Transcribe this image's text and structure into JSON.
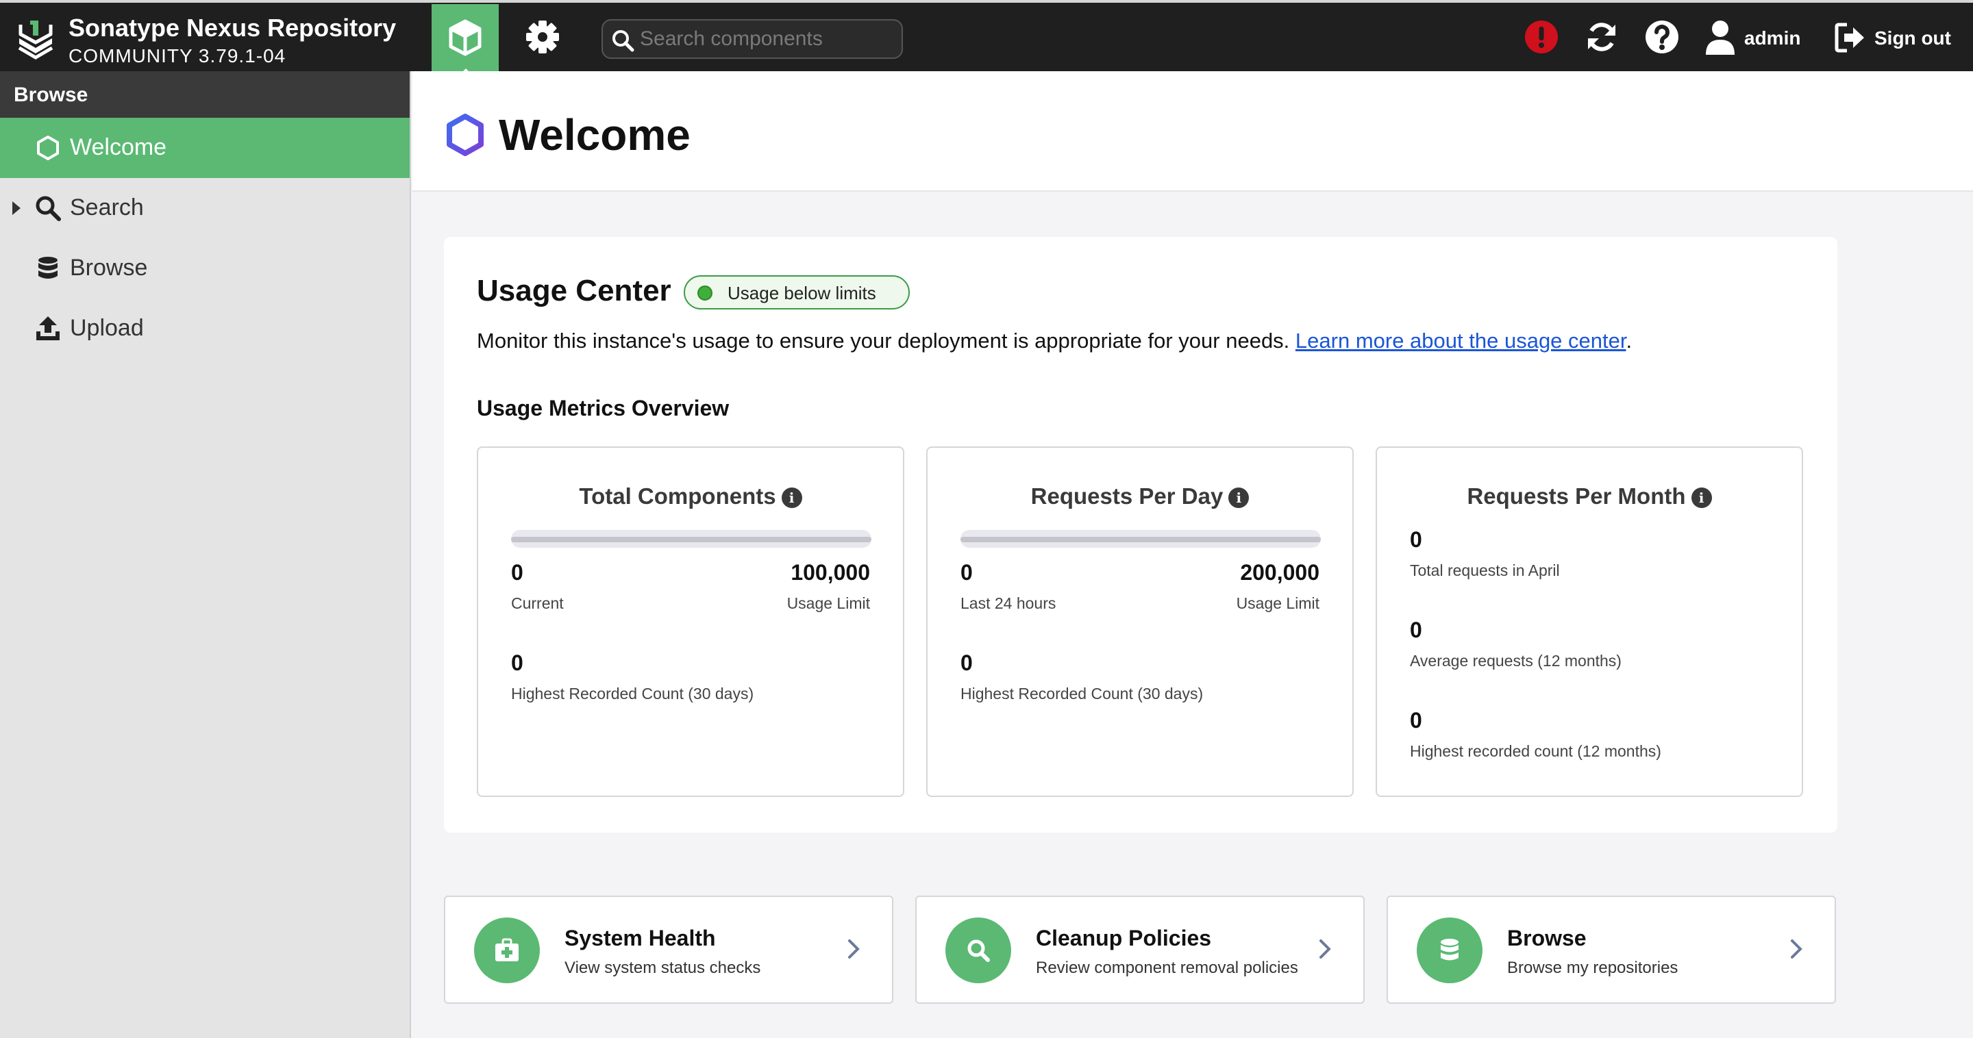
{
  "app": {
    "name": "Sonatype Nexus Repository",
    "version": "COMMUNITY 3.79.1-04"
  },
  "topbar": {
    "search_placeholder": "Search components",
    "user_label": "admin",
    "signout_label": "Sign out",
    "accent_color": "#5bb974",
    "alert_color": "#d0101c"
  },
  "sidebar": {
    "header": "Browse",
    "items": [
      {
        "label": "Welcome",
        "icon": "hexagon-icon",
        "active": true
      },
      {
        "label": "Search",
        "icon": "search-icon",
        "expandable": true
      },
      {
        "label": "Browse",
        "icon": "database-icon"
      },
      {
        "label": "Upload",
        "icon": "upload-icon"
      }
    ]
  },
  "page": {
    "title": "Welcome"
  },
  "usage_center": {
    "title": "Usage Center",
    "status_badge": "Usage below limits",
    "description": "Monitor this instance's usage to ensure your deployment is appropriate for your needs.",
    "link_text": "Learn more about the usage center",
    "link_suffix": ".",
    "metrics_heading": "Usage Metrics Overview",
    "metrics": [
      {
        "title": "Total Components",
        "current_value": "0",
        "current_label": "Current",
        "limit_value": "100,000",
        "limit_label": "Usage Limit",
        "usage_fraction": 0,
        "highest_value": "0",
        "highest_label": "Highest Recorded Count (30 days)"
      },
      {
        "title": "Requests Per Day",
        "current_value": "0",
        "current_label": "Last 24 hours",
        "limit_value": "200,000",
        "limit_label": "Usage Limit",
        "usage_fraction": 0,
        "highest_value": "0",
        "highest_label": "Highest Recorded Count (30 days)"
      },
      {
        "title": "Requests Per Month",
        "stats": [
          {
            "value": "0",
            "label": "Total requests in April"
          },
          {
            "value": "0",
            "label": "Average requests (12 months)"
          },
          {
            "value": "0",
            "label": "Highest recorded count (12 months)"
          }
        ]
      }
    ]
  },
  "shortcuts": [
    {
      "title": "System Health",
      "subtitle": "View system status checks",
      "icon": "first-aid-kit-icon"
    },
    {
      "title": "Cleanup Policies",
      "subtitle": "Review component removal policies",
      "icon": "search-icon"
    },
    {
      "title": "Browse",
      "subtitle": "Browse my repositories",
      "icon": "database-icon"
    }
  ]
}
